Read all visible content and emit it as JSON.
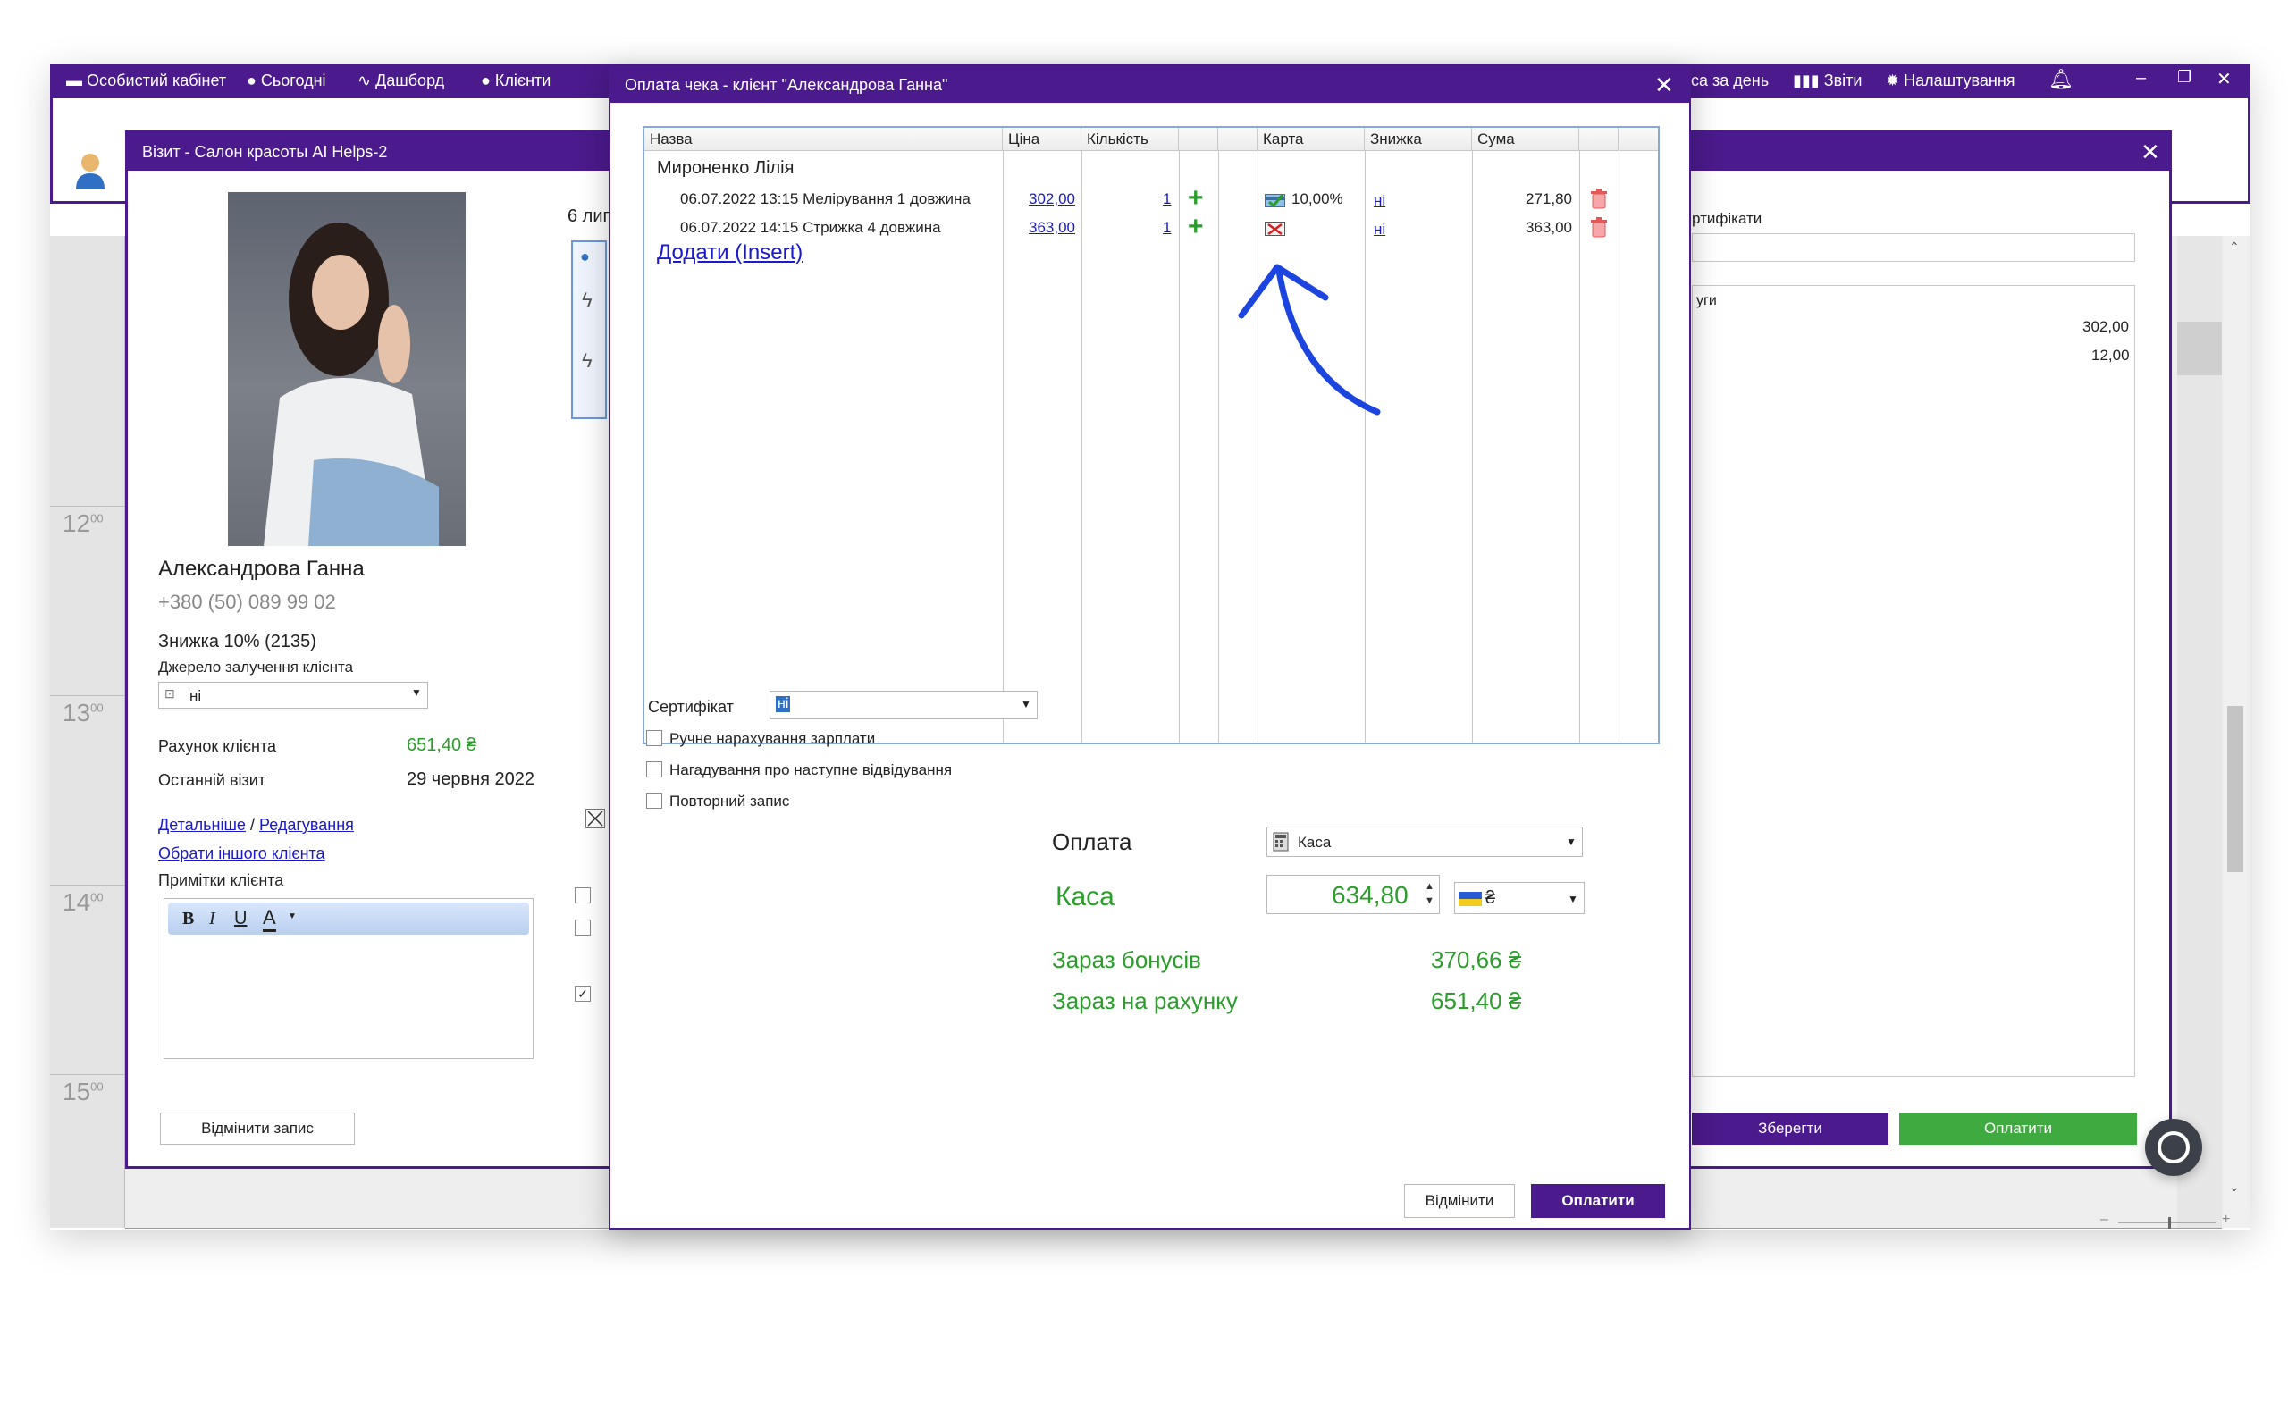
{
  "colors": {
    "purple": "#4b1a8c",
    "green": "#2a9d2a",
    "link": "#1a1acc",
    "save_btn": "#4b1a8c",
    "pay_btn": "#3faa3f",
    "arrow": "#1c45e0"
  },
  "topnav": {
    "items": [
      "Особистий кабінет",
      "Сьогодні",
      "Дашборд",
      "Клієнти"
    ],
    "right_items": [
      "са за день",
      "Звіти",
      "Налаштування"
    ]
  },
  "schedule": {
    "hours": [
      "12",
      "13",
      "14",
      "15"
    ],
    "minutes": "00"
  },
  "visit_window": {
    "title": "Візит - Салон красоты AI Helps-2",
    "client_name": "Александрова Ганна",
    "client_phone": "+380 (50) 089 99 02",
    "discount": "Знижка 10% (2135)",
    "source_label": "Джерело залучення клієнта",
    "source_value": "ні",
    "account_label": "Рахунок клієнта",
    "account_value": "651,40 ₴",
    "last_visit_label": "Останній візит",
    "last_visit_value": "29 червня 2022",
    "details_link": "Детальніше",
    "separator": "/",
    "edit_link": "Редагування",
    "other_client_link": "Обрати іншого клієнта",
    "notes_label": "Примітки клієнта",
    "cancel_btn": "Відмінити запис",
    "date_partial": "6 лип",
    "right_certs_label": "ртифікати",
    "right_services_label": "уги",
    "right_val1": "302,00",
    "right_val2": "12,00",
    "save_btn": "Зберегти",
    "pay_btn": "Оплатити"
  },
  "dialog": {
    "title": "Оплата чека - клієнт \"Александрова Ганна\"",
    "columns": [
      "Назва",
      "Ціна",
      "Кількість",
      "",
      "",
      "Карта",
      "Знижка",
      "Сума",
      ""
    ],
    "master": "Мироненко Лілія",
    "rows": [
      {
        "name": "06.07.2022 13:15 Мелірування 1 довжина",
        "price": "302,00",
        "qty": "1",
        "card": "10,00%",
        "discount": "ні",
        "sum": "271,80"
      },
      {
        "name": "06.07.2022 14:15 Стрижка 4 довжина",
        "price": "363,00",
        "qty": "1",
        "card": "",
        "discount": "ні",
        "sum": "363,00"
      }
    ],
    "add_link": "Додати (Insert)",
    "cert_label": "Сертифікат",
    "cert_value": "ні",
    "checkboxes": [
      "Ручне нарахування зарплати",
      "Нагадування про наступне відвідування",
      "Повторний запис"
    ],
    "payment_label": "Оплата",
    "payment_value": "Каса",
    "kasa_label": "Каса",
    "kasa_amount": "634,80",
    "currency": "₴",
    "bonus_label": "Зараз бонусів",
    "bonus_value": "370,66 ₴",
    "account_label": "Зараз на рахунку",
    "account_value": "651,40 ₴",
    "cancel_btn": "Відмінити",
    "pay_btn": "Оплатити"
  },
  "icons": [
    "cabinet-icon",
    "today-icon",
    "pulse-icon",
    "user-icon",
    "chart-icon",
    "gear-icon",
    "bell-icon",
    "close-icon",
    "plus-icon",
    "trash-icon",
    "card-ok-icon",
    "card-none-icon",
    "calculator-icon",
    "flag-ua-icon",
    "arrow-annotation"
  ]
}
